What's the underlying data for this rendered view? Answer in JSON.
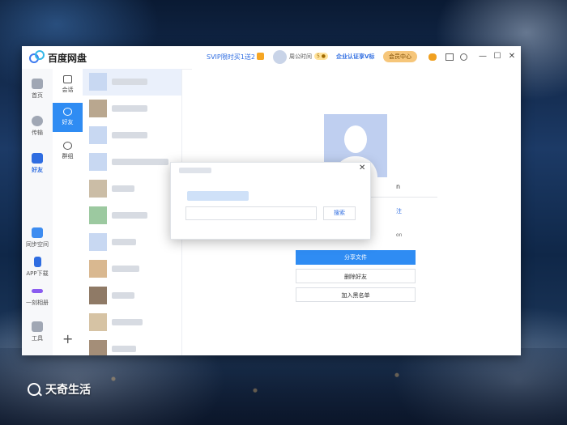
{
  "app": {
    "title": "百度网盘"
  },
  "header": {
    "svip_promo": "SVIP限时买1送2",
    "username": "周公时间",
    "level_badge": "5 ●",
    "certify": "企业认证享V标",
    "member_center": "会员中心",
    "window_controls": {
      "minimize": "—",
      "maximize": "☐",
      "close": "✕"
    }
  },
  "rail": {
    "items": [
      {
        "label": "首页",
        "icon": "cloud-icon"
      },
      {
        "label": "传输",
        "icon": "transfer-icon"
      },
      {
        "label": "好友",
        "icon": "friends-icon",
        "active": true
      },
      {
        "label": "同步空间",
        "icon": "sync-space-icon"
      },
      {
        "label": "APP下载",
        "icon": "phone-icon"
      },
      {
        "label": "一刻相册",
        "icon": "album-icon"
      },
      {
        "label": "工具",
        "icon": "tools-icon"
      }
    ]
  },
  "subrail": {
    "items": [
      {
        "label": "会话",
        "icon": "chat-icon"
      },
      {
        "label": "好友",
        "icon": "friend-icon",
        "active": true
      },
      {
        "label": "群组",
        "icon": "group-icon"
      }
    ],
    "add": "+"
  },
  "profile": {
    "name_partial": "n",
    "link_partial": "注",
    "info_partial": "on",
    "share_button": "分享文件",
    "delete_button": "删除好友",
    "block_button": "加入黑名单"
  },
  "dialog": {
    "close": "✕",
    "search_button": "搜索"
  },
  "watermark": {
    "text": "天奇生活"
  }
}
